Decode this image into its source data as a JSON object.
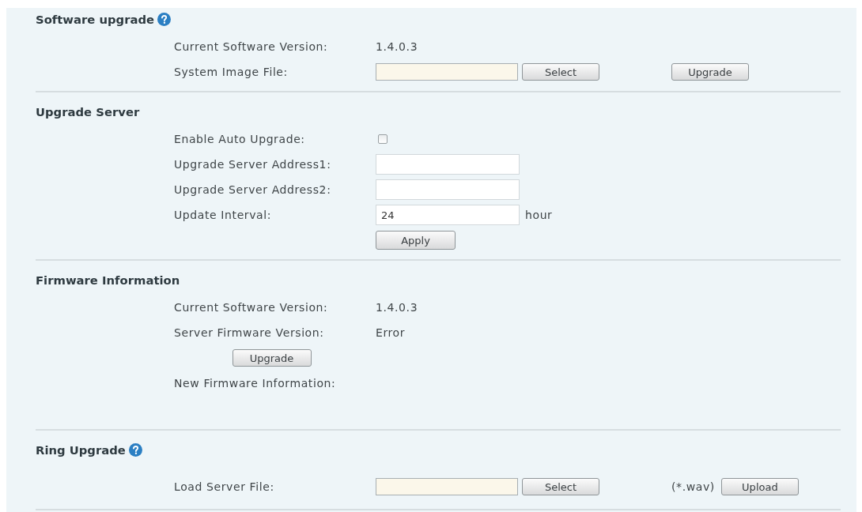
{
  "sections": [
    {
      "title": "Software upgrade",
      "help": true,
      "rows": [
        {
          "kind": "text",
          "label": "Current Software Version:",
          "value": "1.4.0.3"
        },
        {
          "kind": "file",
          "label": "System Image File:",
          "button": "Select",
          "action": "Upgrade"
        }
      ]
    },
    {
      "title": "Upgrade Server",
      "rows": [
        {
          "kind": "checkbox",
          "label": "Enable Auto Upgrade:",
          "checked": false
        },
        {
          "kind": "input",
          "label": "Upgrade Server Address1:"
        },
        {
          "kind": "input",
          "label": "Upgrade Server Address2:"
        },
        {
          "kind": "input",
          "label": "Update Interval:",
          "value": "24",
          "unit": "hour"
        },
        {
          "kind": "button",
          "button": "Apply"
        }
      ]
    },
    {
      "title": "Firmware Information",
      "rows": [
        {
          "kind": "text",
          "label": "Current Software Version:",
          "value": "1.4.0.3"
        },
        {
          "kind": "text",
          "label": "Server Firmware Version:",
          "value": "Error"
        },
        {
          "kind": "label_button",
          "button": "Upgrade"
        },
        {
          "kind": "info",
          "label": "New Firmware Information:"
        }
      ]
    },
    {
      "title": "Ring Upgrade",
      "help": true,
      "rows": [
        {
          "kind": "file",
          "label": "Load Server File:",
          "button": "Select",
          "hint": "(*.wav)",
          "action": "Upload"
        }
      ]
    }
  ]
}
